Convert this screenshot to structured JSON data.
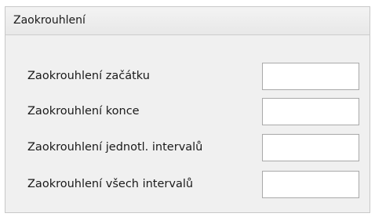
{
  "panel": {
    "title": "Zaokrouhlení"
  },
  "fields": [
    {
      "label": "Zaokrouhlení začátku",
      "value": ""
    },
    {
      "label": "Zaokrouhlení konce",
      "value": ""
    },
    {
      "label": "Zaokrouhlení jednotl. intervalů",
      "value": ""
    },
    {
      "label": "Zaokrouhlení všech intervalů",
      "value": ""
    }
  ]
}
